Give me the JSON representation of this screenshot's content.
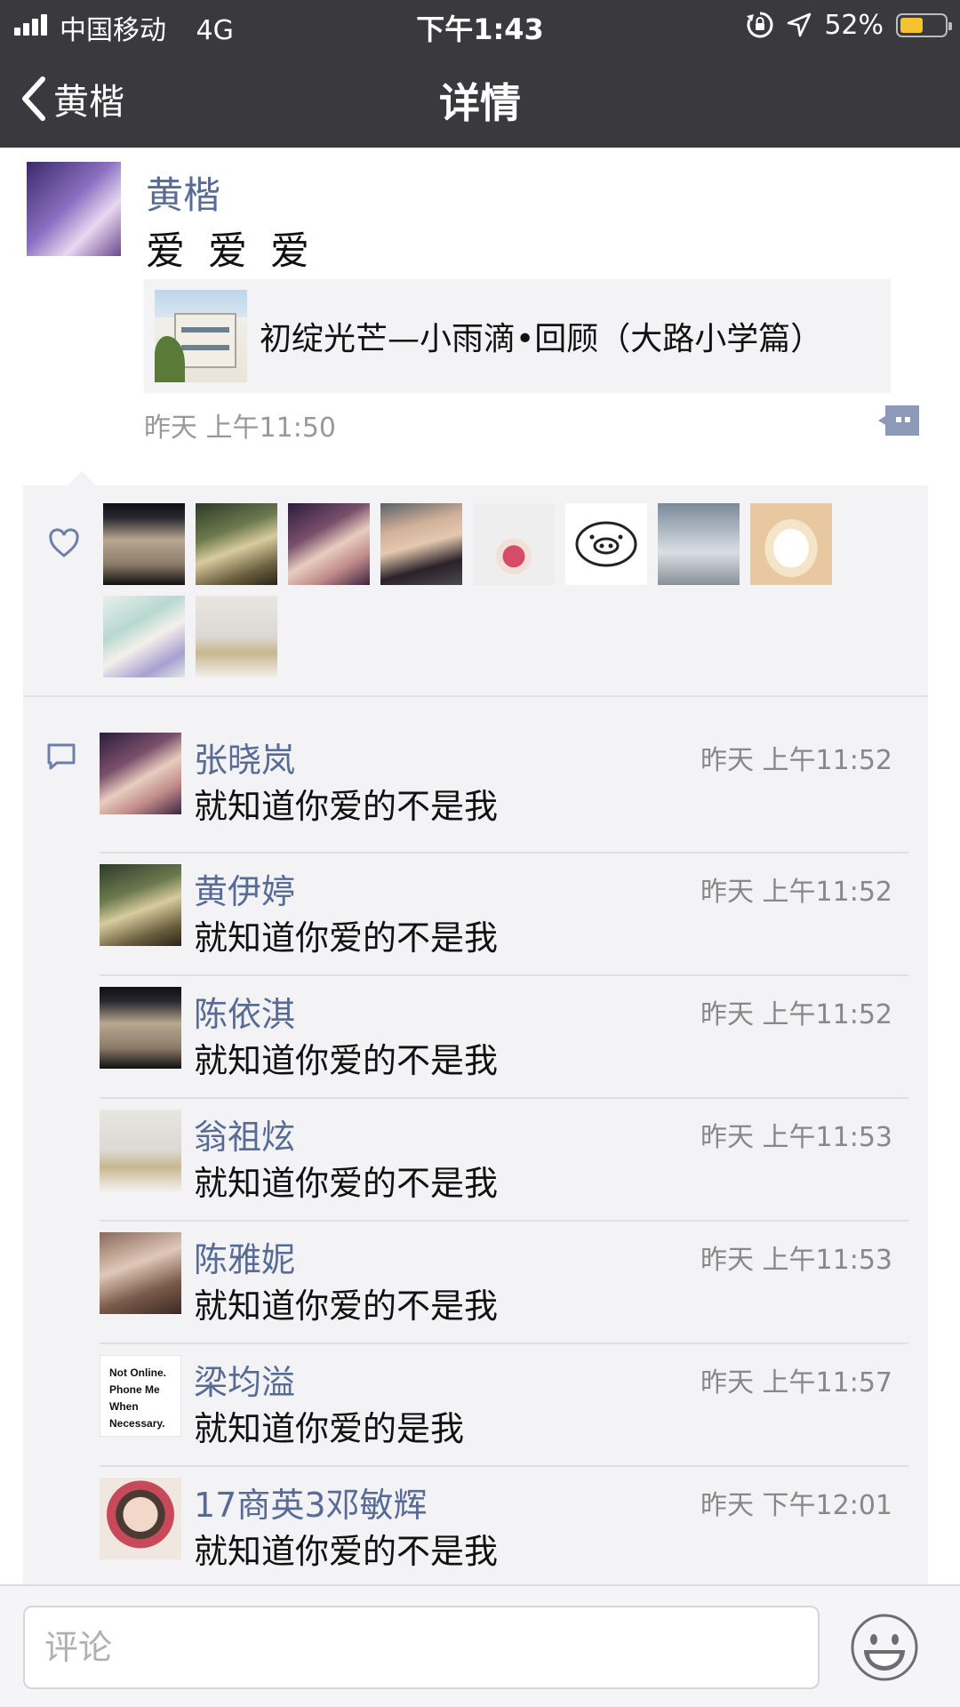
{
  "status_bar": {
    "carrier": "中国移动",
    "network": "4G",
    "time": "下午1:43",
    "battery_percent": "52%",
    "battery_level": 0.52,
    "icons": [
      "signal-icon",
      "orientation-lock-icon",
      "location-icon",
      "battery-icon"
    ]
  },
  "nav": {
    "back_label": "黄楷",
    "title": "详情"
  },
  "post": {
    "author": "黄楷",
    "text": "爱 爱 爱",
    "link": {
      "title": "初绽光芒—小雨滴•回顾（大路小学篇）"
    },
    "time": "昨天 上午11:50"
  },
  "likes": {
    "icon": "heart-icon",
    "avatars": [
      "av1",
      "av2",
      "av3",
      "av4",
      "av5",
      "av6",
      "av7",
      "av8",
      "av9",
      "av10"
    ]
  },
  "comments": {
    "icon": "comment-icon",
    "items": [
      {
        "name": "张晓岚",
        "time": "昨天 上午11:52",
        "text": "就知道你爱的不是我",
        "avatar": "av3"
      },
      {
        "name": "黄伊婷",
        "time": "昨天 上午11:52",
        "text": "就知道你爱的不是我",
        "avatar": "av2"
      },
      {
        "name": "陈依淇",
        "time": "昨天 上午11:52",
        "text": "就知道你爱的不是我",
        "avatar": "av1"
      },
      {
        "name": "翁祖炫",
        "time": "昨天 上午11:53",
        "text": "就知道你爱的不是我",
        "avatar": "av10"
      },
      {
        "name": "陈雅妮",
        "time": "昨天 上午11:53",
        "text": "就知道你爱的不是我",
        "avatar": "av11"
      },
      {
        "name": "梁均溢",
        "time": "昨天 上午11:57",
        "text": "就知道你爱的是我",
        "avatar": "av12",
        "avatar_text": "Not Online. Phone Me When Necessary."
      },
      {
        "name": "17商英3邓敏辉",
        "time": "昨天 下午12:01",
        "text": "就知道你爱的不是我",
        "avatar": "av13"
      }
    ]
  },
  "input": {
    "placeholder": "评论",
    "value": ""
  },
  "colors": {
    "nav_background": "#3a3a3e",
    "link_name": "#576b95",
    "panel_background": "#f3f3f5",
    "battery_fill": "#f4c430"
  }
}
